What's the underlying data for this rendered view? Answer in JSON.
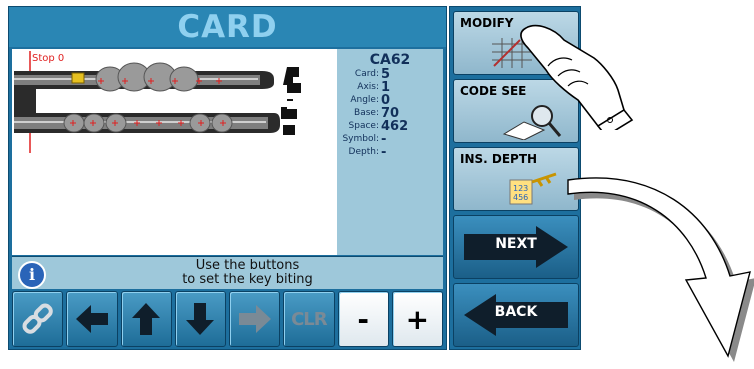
{
  "screen": {
    "title": "CARD",
    "stop_label": "Stop 0",
    "message_line1": "Use the buttons",
    "message_line2": "to set the key biting"
  },
  "info": {
    "code": "CA62",
    "rows": [
      {
        "label": "Card:",
        "value": "5"
      },
      {
        "label": "Axis:",
        "value": "1"
      },
      {
        "label": "Angle:",
        "value": "0"
      },
      {
        "label": "Base:",
        "value": "70"
      },
      {
        "label": "Space:",
        "value": "462"
      },
      {
        "label": "Symbol:",
        "value": "-"
      },
      {
        "label": "Depth:",
        "value": "-"
      }
    ]
  },
  "keypad": {
    "clr": "CLR",
    "minus": "-",
    "plus": "+"
  },
  "side_buttons": {
    "modify": "MODIFY",
    "code_search": "CODE SEE",
    "ins_depth": "INS. DEPTH",
    "next": "NEXT",
    "back": "BACK"
  },
  "depth_tag": {
    "line1": "123",
    "line2": "456"
  },
  "colors": {
    "panel": "#1d6f9e",
    "accent": "#2a86b4",
    "info_bg": "#9ec8da"
  }
}
